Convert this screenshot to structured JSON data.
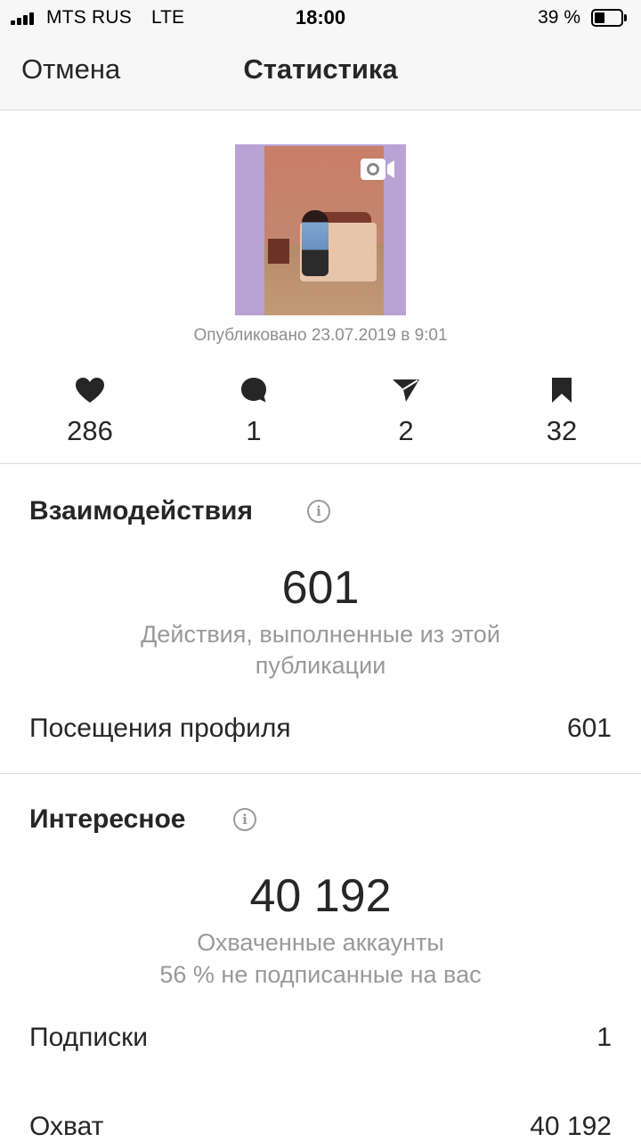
{
  "status_bar": {
    "carrier": "MTS RUS",
    "network": "LTE",
    "time": "18:00",
    "battery_percent": "39 %",
    "battery_level": 0.39,
    "signal_bars": 4
  },
  "nav": {
    "cancel_label": "Отмена",
    "title": "Статистика"
  },
  "post": {
    "thumbnail_icon": "video-icon",
    "published": "Опубликовано 23.07.2019 в 9:01"
  },
  "metrics": [
    {
      "icon": "heart-icon",
      "value": "286"
    },
    {
      "icon": "comment-icon",
      "value": "1"
    },
    {
      "icon": "send-icon",
      "value": "2"
    },
    {
      "icon": "bookmark-icon",
      "value": "32"
    }
  ],
  "interactions": {
    "title": "Взаимодействия",
    "total": "601",
    "caption": "Действия, выполненные из этой публикации",
    "rows": [
      {
        "label": "Посещения профиля",
        "value": "601"
      }
    ]
  },
  "discovery": {
    "title": "Интересное",
    "total": "40 192",
    "caption_line1": "Охваченные аккаунты",
    "caption_line2": "56 % не подписанные на вас",
    "rows": [
      {
        "label": "Подписки",
        "value": "1"
      },
      {
        "label": "Охват",
        "value": "40 192"
      }
    ]
  },
  "colors": {
    "background": "#ffffff",
    "bar_background": "#f7f7f7",
    "text": "#262626",
    "secondary_text": "#8e8e8e",
    "thumbnail_border": "#b9a3d4"
  }
}
